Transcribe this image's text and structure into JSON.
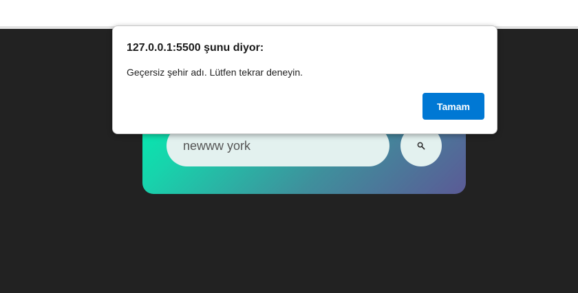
{
  "alert": {
    "title": "127.0.0.1:5500 şunu diyor:",
    "message": "Geçersiz şehir adı. Lütfen tekrar deneyin.",
    "ok_label": "Tamam",
    "ok_color": "#0078d4"
  },
  "search": {
    "value": "newww york",
    "button_icon": "search-icon"
  },
  "colors": {
    "page_background": "#222222",
    "card_gradient_start": "#00eeb0",
    "card_gradient_end": "#5b5a96"
  }
}
